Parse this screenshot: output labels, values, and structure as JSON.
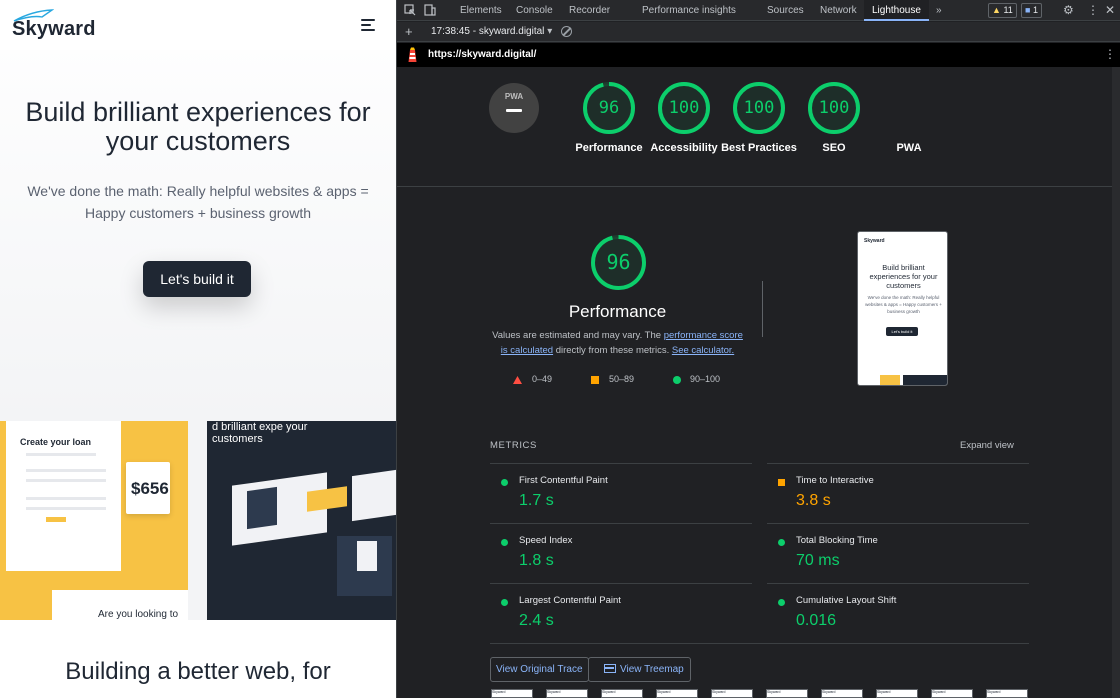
{
  "site": {
    "logo": "Skyward",
    "hero_title": "Build brilliant experiences for your customers",
    "hero_subtitle": "We've done the math: Really helpful websites & apps = Happy customers + business growth",
    "cta": "Let's build it",
    "loan_card": {
      "title": "Create your loan",
      "amount": "$656",
      "question": "Are you looking to"
    },
    "dark_card": {
      "headline": "d brilliant expe your customers"
    },
    "bottom_title": "Building a better web, for"
  },
  "devtools": {
    "tabs": [
      "Elements",
      "Console",
      "Recorder",
      "Performance insights",
      "Sources",
      "Network",
      "Lighthouse"
    ],
    "active_tab": "Lighthouse",
    "warnings_count": "11",
    "messages_count": "1",
    "report_label": "17:38:45 - skyward.digital",
    "url": "https://skyward.digital/",
    "scores": [
      {
        "label": "Performance",
        "score": 96
      },
      {
        "label": "Accessibility",
        "score": 100
      },
      {
        "label": "Best Practices",
        "score": 100
      },
      {
        "label": "SEO",
        "score": 100
      }
    ],
    "pwa": {
      "label": "PWA",
      "badge": "PWA"
    },
    "performance": {
      "score": 96,
      "title": "Performance",
      "desc_prefix": "Values are estimated and may vary. The ",
      "desc_link1": "performance score is calculated",
      "desc_middle": " directly from these metrics. ",
      "desc_link2": "See calculator.",
      "legend": [
        {
          "range": "0–49",
          "color": "#ff4e42"
        },
        {
          "range": "50–89",
          "color": "#ffa400"
        },
        {
          "range": "90–100",
          "color": "#0cce6b"
        }
      ]
    },
    "thumbnail": {
      "logo": "Skyward",
      "title": "Build brilliant experiences for your customers",
      "subtitle": "We've done the math: Really helpful websites & apps = Happy customers + business growth",
      "button": "Let's build it"
    },
    "metrics_heading": "METRICS",
    "expand_view": "Expand view",
    "metrics": [
      {
        "name": "First Contentful Paint",
        "value": "1.7 s",
        "status": "green"
      },
      {
        "name": "Time to Interactive",
        "value": "3.8 s",
        "status": "orange"
      },
      {
        "name": "Speed Index",
        "value": "1.8 s",
        "status": "green"
      },
      {
        "name": "Total Blocking Time",
        "value": "70 ms",
        "status": "green"
      },
      {
        "name": "Largest Contentful Paint",
        "value": "2.4 s",
        "status": "green"
      },
      {
        "name": "Cumulative Layout Shift",
        "value": "0.016",
        "status": "green"
      }
    ],
    "buttons": {
      "view_trace": "View Original Trace",
      "view_treemap": "View Treemap"
    },
    "filmstrip_label": "Skyward"
  },
  "colors": {
    "pass": "#0cce6b",
    "average": "#ffa400",
    "fail": "#ff4e42",
    "link": "#8ab4f8"
  }
}
